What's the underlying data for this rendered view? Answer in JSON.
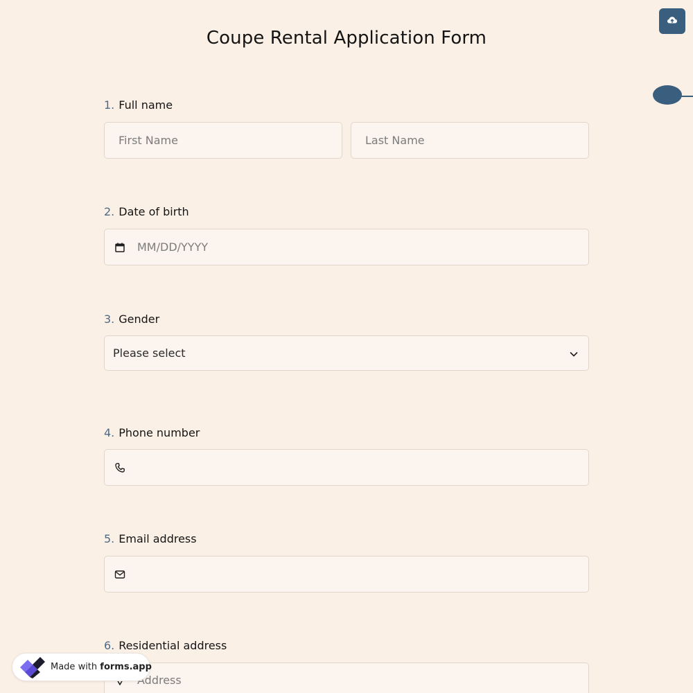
{
  "form": {
    "title": "Coupe Rental Application Form"
  },
  "upload_button": {
    "icon": "cloud-upload-icon"
  },
  "questions": [
    {
      "number": "1.",
      "label": "Full name",
      "fields": [
        {
          "placeholder": "First Name"
        },
        {
          "placeholder": "Last Name"
        }
      ]
    },
    {
      "number": "2.",
      "label": "Date of birth",
      "icon": "calendar-icon",
      "placeholder": "MM/DD/YYYY"
    },
    {
      "number": "3.",
      "label": "Gender",
      "selected": "Please select",
      "icon": "chevron-down-icon"
    },
    {
      "number": "4.",
      "label": "Phone number",
      "icon": "phone-icon",
      "placeholder": ""
    },
    {
      "number": "5.",
      "label": "Email address",
      "icon": "mail-icon",
      "placeholder": ""
    },
    {
      "number": "6.",
      "label": "Residential address",
      "icon": "location-icon",
      "placeholder": "Address"
    }
  ],
  "badge": {
    "prefix": "Made with",
    "brand": "forms.app",
    "icon": "forms-app-logo-icon"
  },
  "colors": {
    "background": "#faf0e6",
    "field_background": "#fcf4ee",
    "accent": "#3a5e7e",
    "number": "#4f6a85"
  }
}
